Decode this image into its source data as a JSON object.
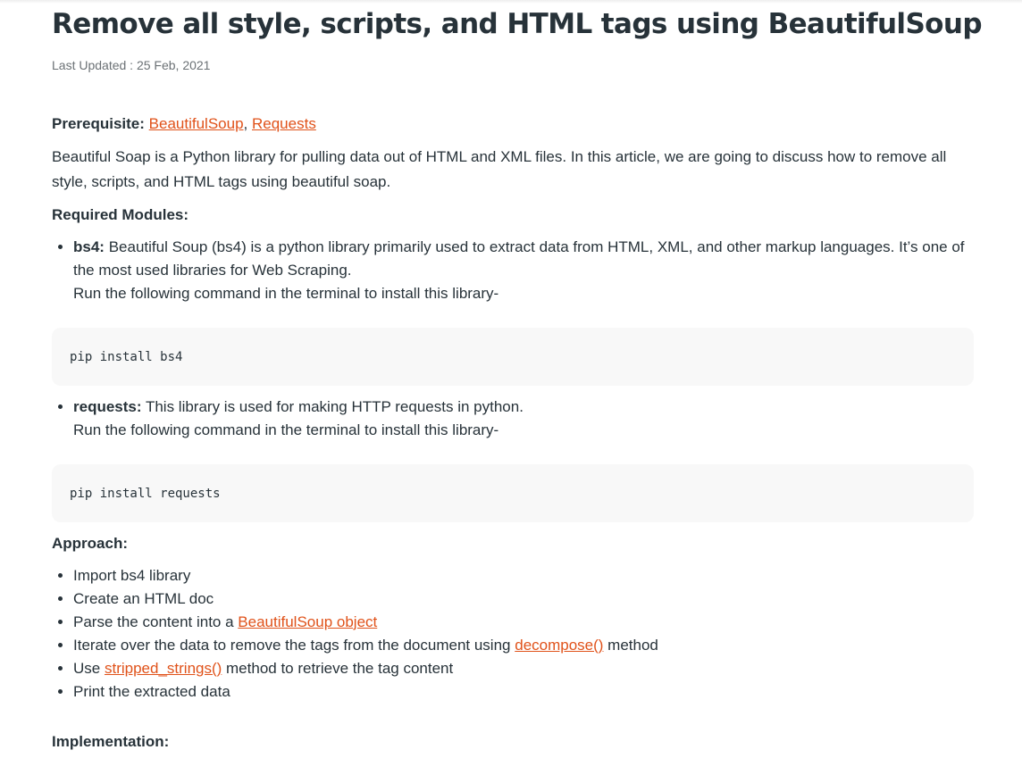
{
  "article": {
    "title": "Remove all style, scripts, and HTML tags using BeautifulSoup",
    "last_updated": "Last Updated : 25 Feb, 2021",
    "prerequisite": {
      "label": "Prerequisite:",
      "links": [
        "BeautifulSoup",
        "Requests"
      ],
      "separator": ", "
    },
    "intro": "Beautiful Soap is a Python library for pulling data out of HTML and XML files. In this article, we are going to discuss how to remove all style, scripts, and HTML tags using beautiful soap.",
    "required_modules_heading": "Required Modules:",
    "modules": [
      {
        "name": "bs4:",
        "description": " Beautiful Soup (bs4) is a python library primarily used to extract data from HTML, XML, and other markup languages. It’s one of the most used libraries for Web Scraping.",
        "install_note": "Run the following command in the terminal to install this library-",
        "command": "pip install bs4"
      },
      {
        "name": "requests:",
        "description": " This library is used for making HTTP requests in python.",
        "install_note": "Run the following command in the terminal to install this library-",
        "command": "pip install requests"
      }
    ],
    "approach_heading": "Approach:",
    "steps": {
      "s1": "Import bs4 library",
      "s2": "Create an HTML doc",
      "s3_prefix": "Parse the content into a ",
      "s3_link": "BeautifulSoup object",
      "s4_prefix": "Iterate over the data to remove the tags from the document using ",
      "s4_link": "decompose()",
      "s4_suffix": " method",
      "s5_prefix": "Use ",
      "s5_link": "stripped_strings()",
      "s5_suffix": " method to retrieve the tag content",
      "s6": "Print the extracted data"
    },
    "implementation_heading": "Implementation:"
  },
  "colors": {
    "link": "#e0521a",
    "text": "#273239",
    "code_bg": "#f8f8f8"
  }
}
